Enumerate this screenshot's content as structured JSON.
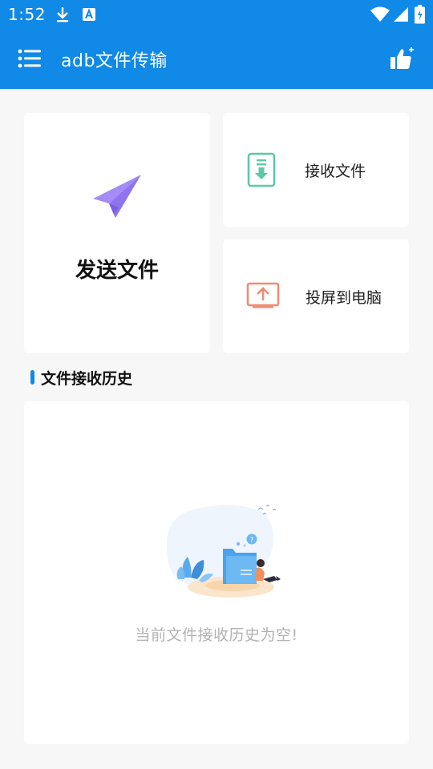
{
  "status_bar": {
    "time": "1:52",
    "icons": [
      "download-icon",
      "a-text-icon",
      "wifi-icon",
      "signal-icon",
      "battery-icon"
    ]
  },
  "app_bar": {
    "title": "adb文件传输",
    "menu_icon": "menu-icon",
    "action_icon": "thumbs-up-icon",
    "color": "#1189e6"
  },
  "actions": {
    "send": {
      "label": "发送文件",
      "icon": "paper-plane-icon",
      "color": "#a38cf6"
    },
    "receive": {
      "label": "接收文件",
      "icon": "download-file-icon",
      "color": "#5ec7a8"
    },
    "project": {
      "label": "投屏到电脑",
      "icon": "upload-screen-icon",
      "color": "#ee8d76"
    }
  },
  "history": {
    "section_title": "文件接收历史",
    "empty_text": "当前文件接收历史为空!",
    "empty_icon": "empty-folder-illustration"
  }
}
